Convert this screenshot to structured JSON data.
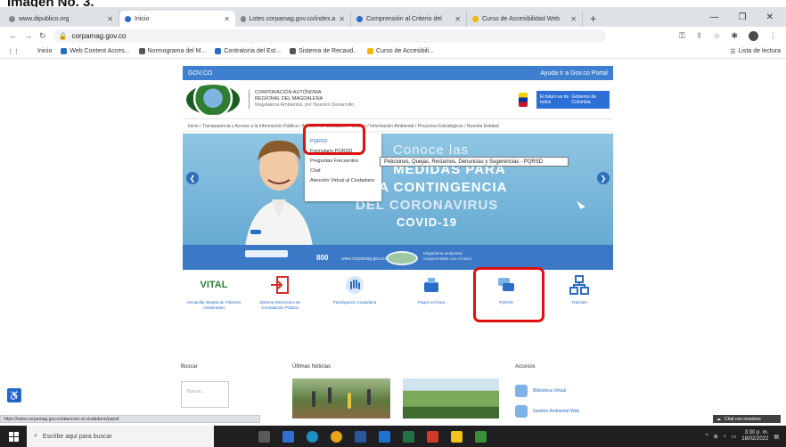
{
  "caption": "Imagen No. 3.",
  "browser": {
    "tabs": [
      {
        "label": "www.dipublico.org"
      },
      {
        "label": "Inicio"
      },
      {
        "label": "Lotes corpamag.gov.co/index.a"
      },
      {
        "label": "Comprensión al Criterio del"
      },
      {
        "label": "Curso de Accesibilidad Web"
      }
    ],
    "new_tab": "+",
    "url": "corpamag.gov.co",
    "bookmarks": [
      {
        "label": "Inicio",
        "color": "#888888"
      },
      {
        "label": "Web Content Acces...",
        "color": "#2b6cc4"
      },
      {
        "label": "Normograma del M...",
        "color": "#555555"
      },
      {
        "label": "Contraloría del Est...",
        "color": "#2b6cc4"
      },
      {
        "label": "Sistema de Recaud...",
        "color": "#555555"
      },
      {
        "label": "Curso de Accesibili...",
        "color": "#f2b705"
      }
    ],
    "reading_list": "Lista de lectura"
  },
  "site": {
    "gov_bar": "GOV.CO",
    "gov_links": "Ayuda    Ir a Gov.co Portal",
    "corp_name_1": "CORPORACIÓN AUTÓNOMA",
    "corp_name_2": "REGIONAL DEL MAGDALENA",
    "corp_sub": "Magdalena Ambiental, por Nuestro Desarrollo",
    "gob_label": "El futuro es de todos",
    "gob_right": "Gobierno de Colombia",
    "nav": "Inicio / Transparencia y Acceso a la Información Pública / Atención al Ciudadano / Noticias / Información Ambiental / Proyectos Estratégicos / Nuestra Entidad",
    "banner": {
      "line1": "Conoce las",
      "line2": "MEDIDAS PARA",
      "line3": "LA CONTINGENCIA",
      "line4": "DEL CORONAVIRUS",
      "line5": "COVID-19",
      "footer1": "800",
      "footer2": "www.corpamag.gov.co",
      "footer3": "Magdalena ambiental, comprometido con el futuro"
    },
    "dropdown": [
      "PQRSD",
      "Formulario PQRSD",
      "Preguntas Frecuentes",
      "Chat",
      "Atención Virtual al Ciudadano"
    ],
    "tooltip": "Peticiones, Quejas, Reclamos, Denuncias y Sugerencias - PQRSD",
    "services": [
      {
        "label": "Ventanilla Integral de Trámites Ambientales",
        "icon": "vital-logo"
      },
      {
        "label": "Sistema Electrónico de Contratación Pública",
        "icon": "login-icon"
      },
      {
        "label": "Participación Ciudadana",
        "icon": "hand-icon"
      },
      {
        "label": "Pagos en línea",
        "icon": "payment-icon"
      },
      {
        "label": "PQRSD",
        "icon": "chat-icon"
      },
      {
        "label": "Trámites",
        "icon": "network-icon"
      }
    ],
    "search_title": "Buscar",
    "search_placeholder": "Buscar...",
    "news_title": "Últimas Noticias",
    "access_title": "Accesos",
    "access_items": [
      "Biblioteca Virtual",
      "Gestión Ambiental Web"
    ],
    "whatsapp": "Chat con nosotros",
    "status_url": "https://www.corpamag.gov.co/atencion-al-ciudadano/pqrsd"
  },
  "taskbar": {
    "search_placeholder": "Escribe aquí para buscar",
    "time": "3:30 p. m.",
    "date": "18/02/2022"
  }
}
